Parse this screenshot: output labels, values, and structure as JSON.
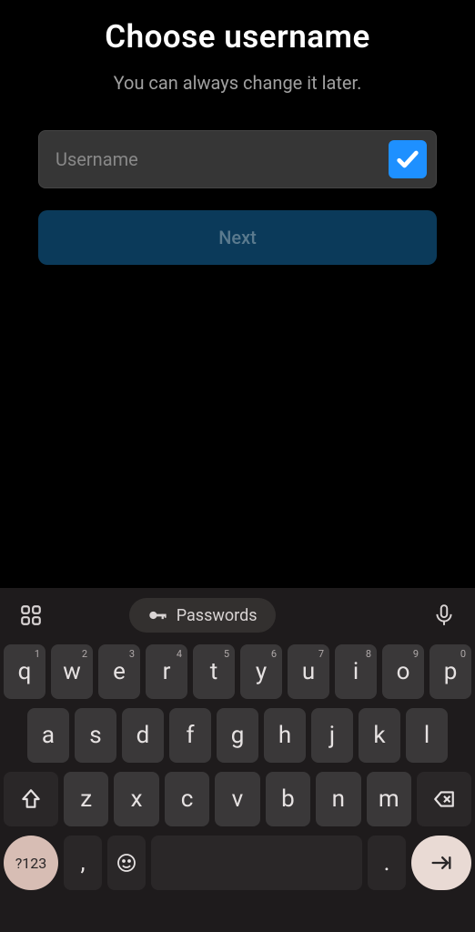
{
  "header": {
    "title": "Choose username",
    "subtitle": "You can always change it later."
  },
  "form": {
    "username_placeholder": "Username",
    "username_value": "",
    "next_label": "Next"
  },
  "keyboard": {
    "passwords_label": "Passwords",
    "row1": [
      {
        "main": "q",
        "sup": "1"
      },
      {
        "main": "w",
        "sup": "2"
      },
      {
        "main": "e",
        "sup": "3"
      },
      {
        "main": "r",
        "sup": "4"
      },
      {
        "main": "t",
        "sup": "5"
      },
      {
        "main": "y",
        "sup": "6"
      },
      {
        "main": "u",
        "sup": "7"
      },
      {
        "main": "i",
        "sup": "8"
      },
      {
        "main": "o",
        "sup": "9"
      },
      {
        "main": "p",
        "sup": "0"
      }
    ],
    "row2": [
      {
        "main": "a"
      },
      {
        "main": "s"
      },
      {
        "main": "d"
      },
      {
        "main": "f"
      },
      {
        "main": "g"
      },
      {
        "main": "h"
      },
      {
        "main": "j"
      },
      {
        "main": "k"
      },
      {
        "main": "l"
      }
    ],
    "row3": [
      {
        "main": "z"
      },
      {
        "main": "x"
      },
      {
        "main": "c"
      },
      {
        "main": "v"
      },
      {
        "main": "b"
      },
      {
        "main": "n"
      },
      {
        "main": "m"
      }
    ],
    "mode_label": "?123",
    "comma": ",",
    "period": "."
  }
}
